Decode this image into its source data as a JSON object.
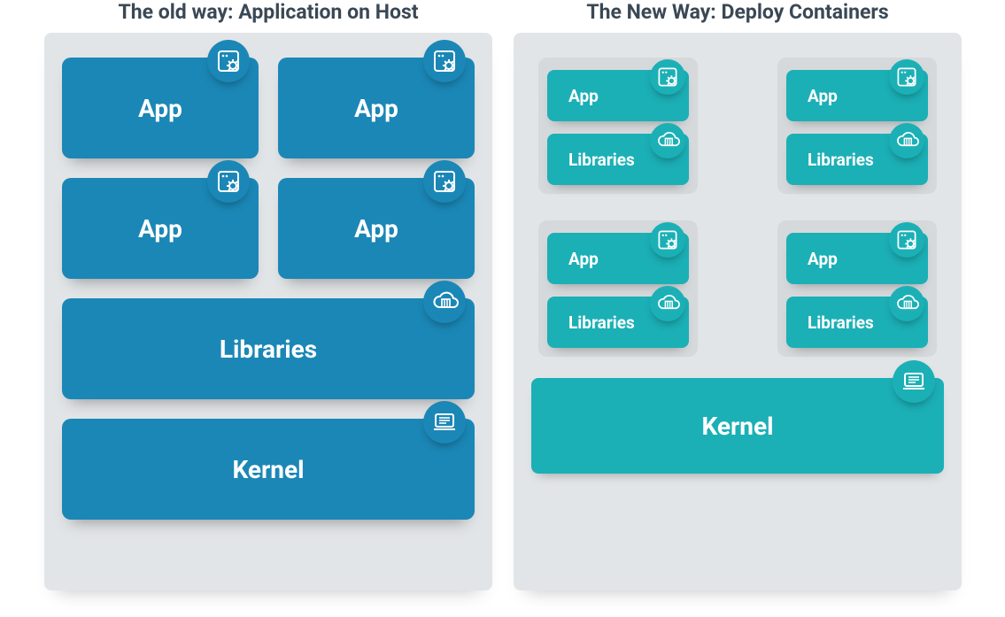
{
  "old": {
    "title": "The old way: Application on Host",
    "app_label": "App",
    "libraries_label": "Libraries",
    "kernel_label": "Kernel"
  },
  "new": {
    "title": "The New Way: Deploy Containers",
    "app_label": "App",
    "libraries_label": "Libraries",
    "kernel_label": "Kernel"
  }
}
